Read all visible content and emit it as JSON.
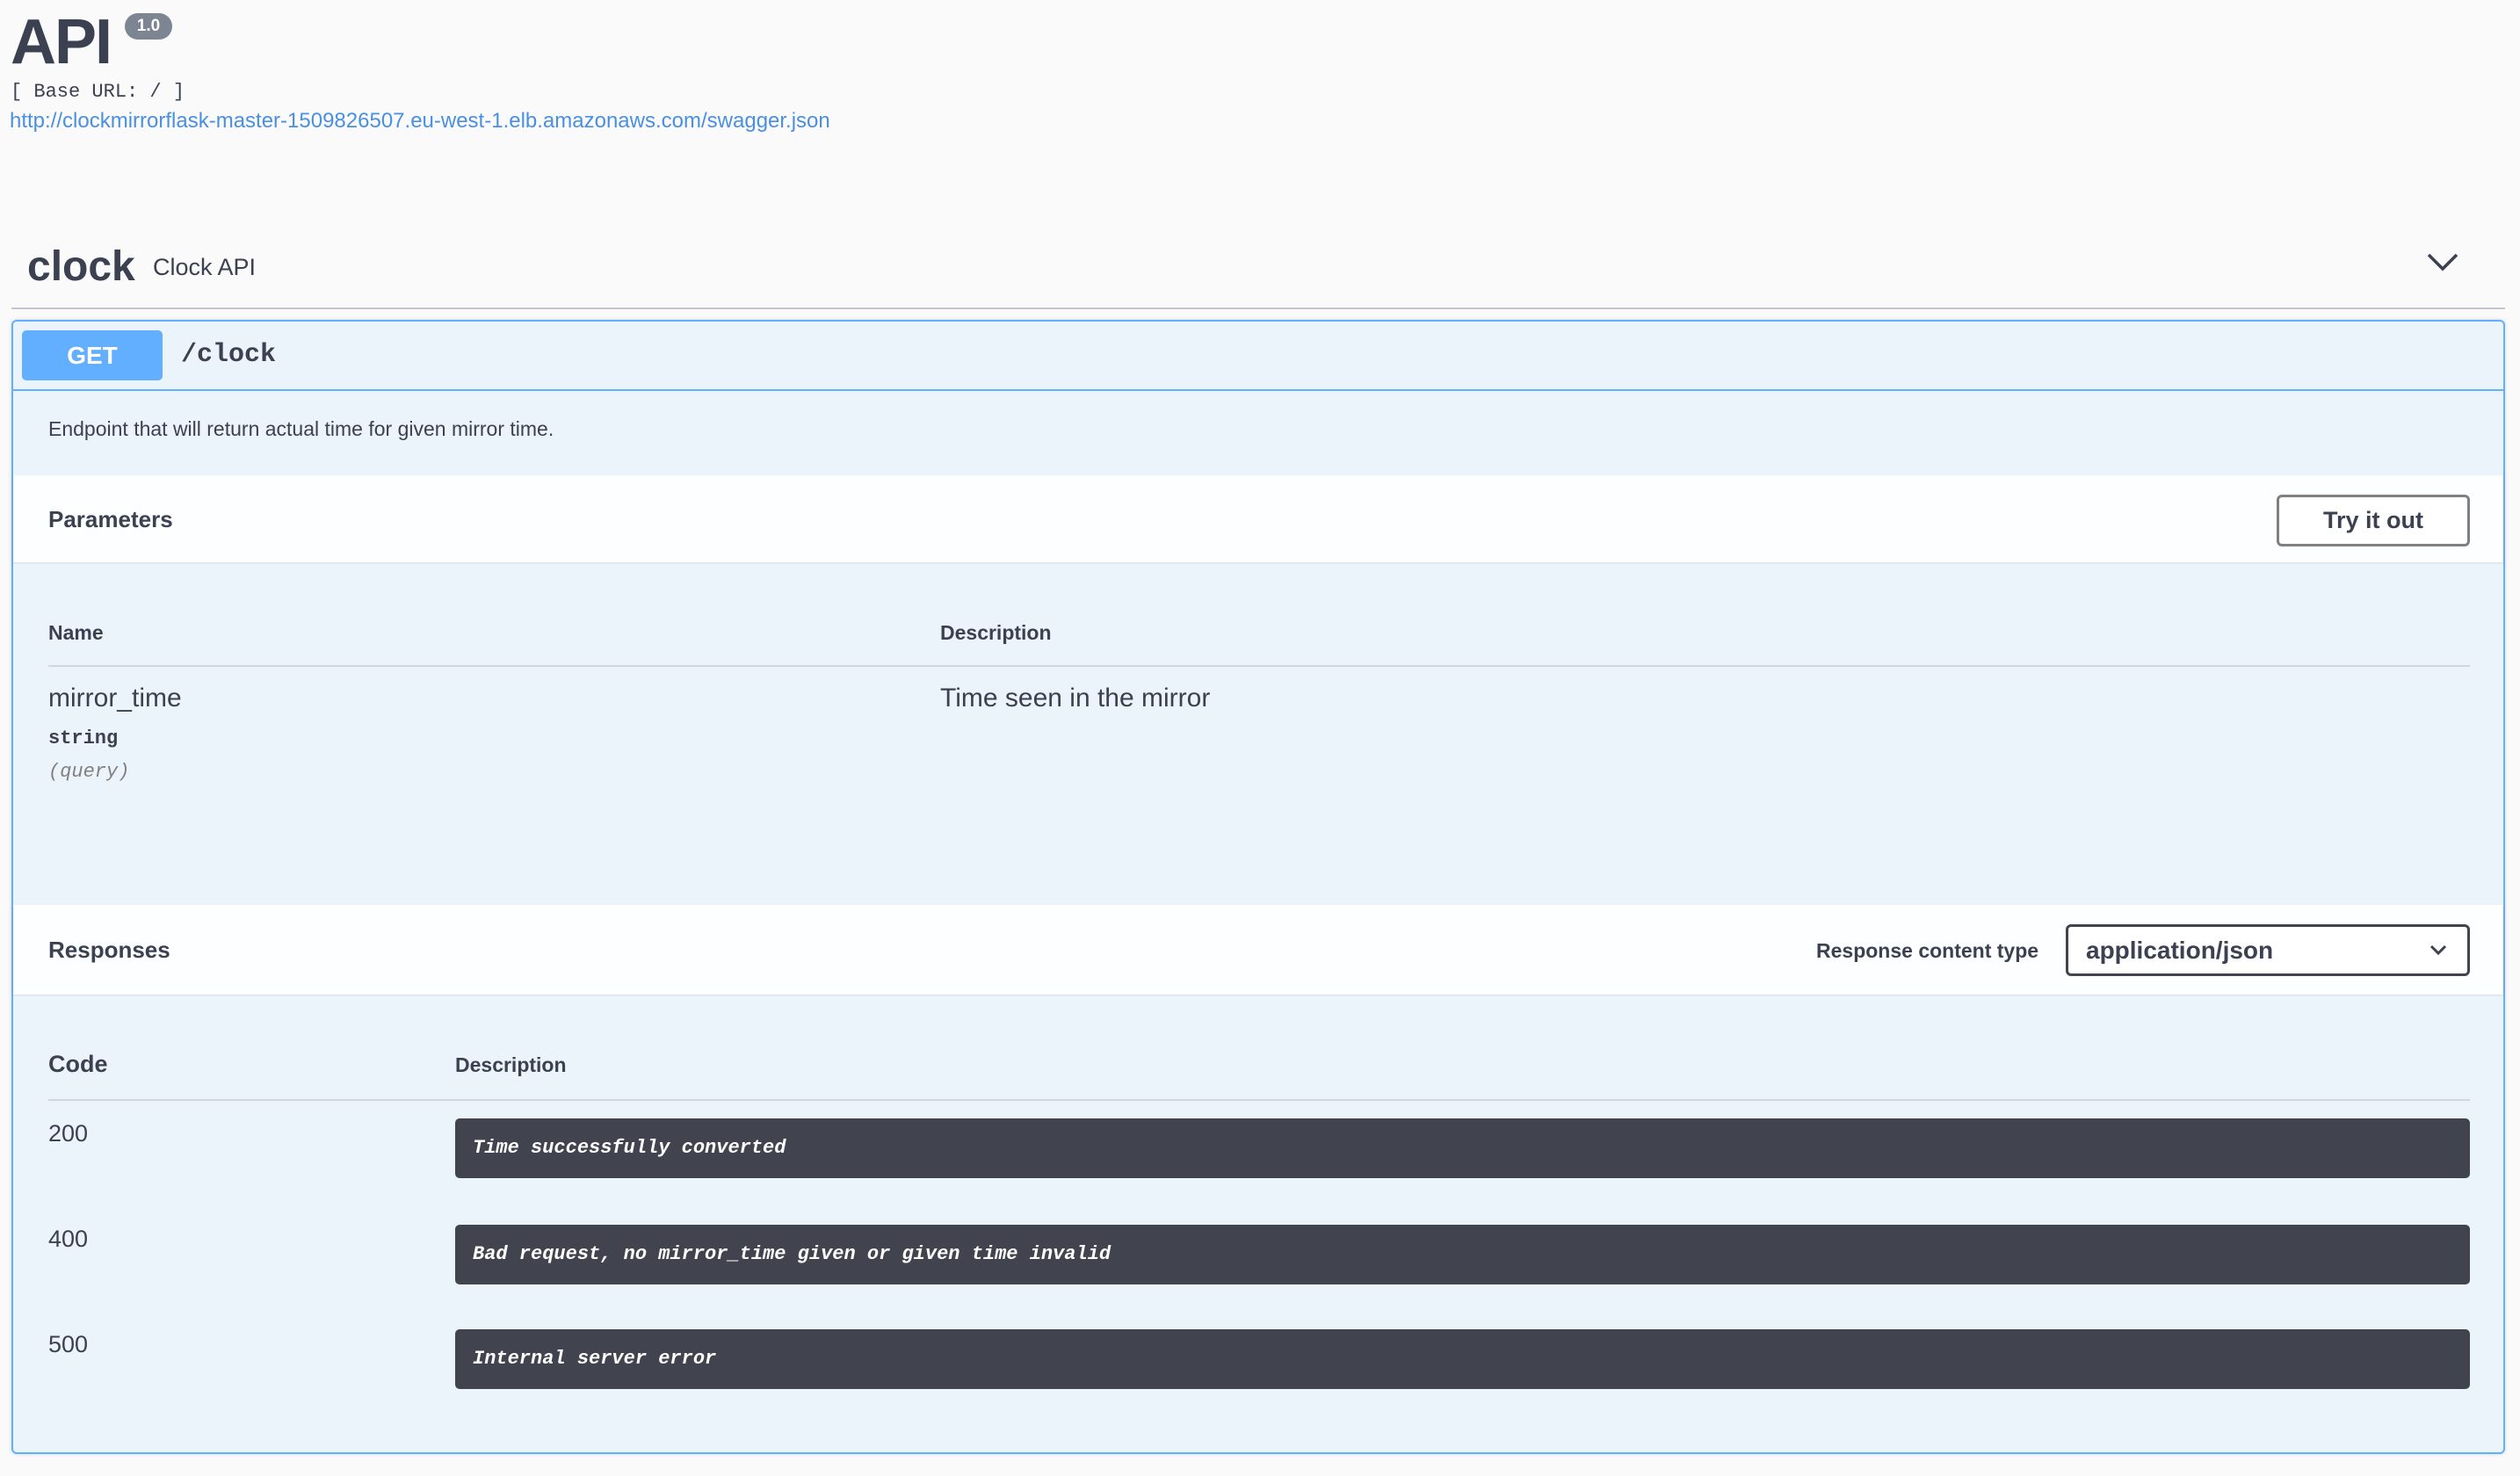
{
  "info": {
    "title": "API",
    "version": "1.0",
    "base_url": "[ Base URL: / ]",
    "spec_url": "http://clockmirrorflask-master-1509826507.eu-west-1.elb.amazonaws.com/swagger.json"
  },
  "tag": {
    "name": "clock",
    "description": "Clock API"
  },
  "operation": {
    "method": "GET",
    "path": "/clock",
    "description": "Endpoint that will return actual time for given mirror time.",
    "parameters": {
      "title": "Parameters",
      "try_label": "Try it out",
      "headers": {
        "name": "Name",
        "description": "Description"
      },
      "items": [
        {
          "name": "mirror_time",
          "type": "string",
          "in": "(query)",
          "description": "Time seen in the mirror"
        }
      ]
    },
    "responses": {
      "title": "Responses",
      "content_type_label": "Response content type",
      "content_type": "application/json",
      "headers": {
        "code": "Code",
        "description": "Description"
      },
      "items": [
        {
          "code": "200",
          "description": "Time successfully converted"
        },
        {
          "code": "400",
          "description": "Bad request, no mirror_time given or given time invalid"
        },
        {
          "code": "500",
          "description": "Internal server error"
        }
      ]
    }
  },
  "colors": {
    "get": "#61affe",
    "text": "#3b4151",
    "opblock_bg": "#ebf3fb",
    "response_box": "#41444e"
  }
}
